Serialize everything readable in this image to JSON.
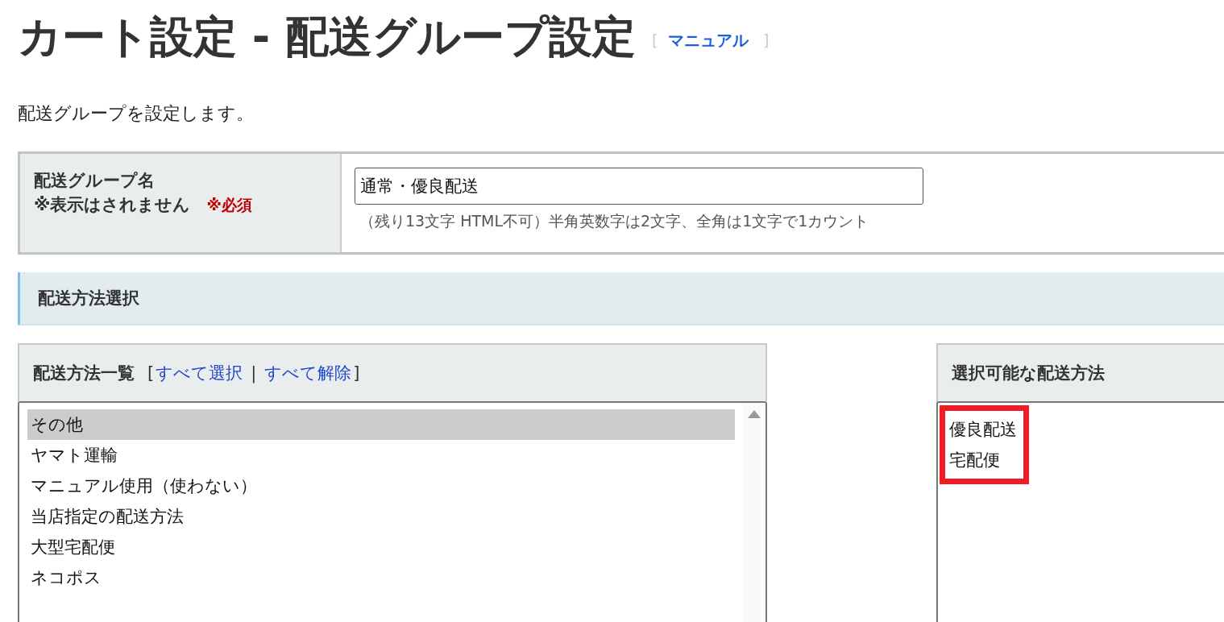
{
  "page": {
    "title": "カート設定 - 配送グループ設定",
    "manual_open": "[",
    "manual_link": "マニュアル",
    "manual_close": "]",
    "description": "配送グループを設定します。"
  },
  "group_name": {
    "label": "配送グループ名",
    "note": "※表示はされません",
    "required": "※必須",
    "value": "通常・優良配送",
    "hint": "（残り13文字 HTML不可）半角英数字は2文字、全角は1文字で1カウント"
  },
  "section": {
    "title": "配送方法選択"
  },
  "method_list": {
    "title": "配送方法一覧",
    "bracket_open": "[",
    "select_all": "すべて選択",
    "separator": "|",
    "deselect_all": "すべて解除",
    "bracket_close": "]",
    "items": [
      {
        "label": "その他",
        "selected": true
      },
      {
        "label": "ヤマト運輸",
        "selected": false
      },
      {
        "label": "マニュアル使用（使わない）",
        "selected": false
      },
      {
        "label": "当店指定の配送方法",
        "selected": false
      },
      {
        "label": "大型宅配便",
        "selected": false
      },
      {
        "label": "ネコポス",
        "selected": false
      }
    ]
  },
  "available_list": {
    "title": "選択可能な配送方法",
    "highlighted": true,
    "items": [
      {
        "label": "優良配送"
      },
      {
        "label": "宅配便"
      }
    ]
  }
}
